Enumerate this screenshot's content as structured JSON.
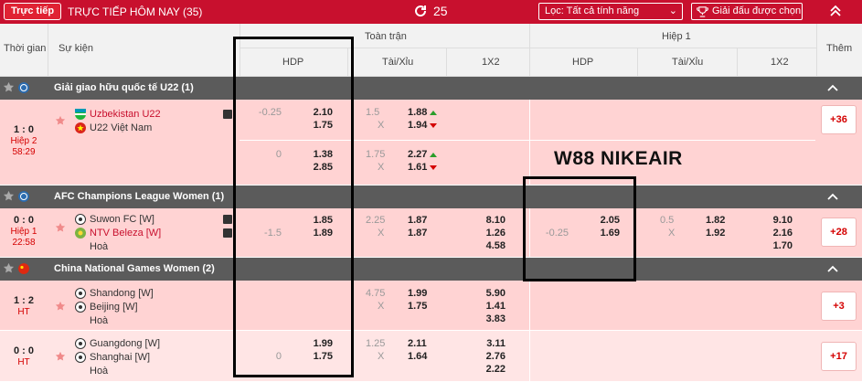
{
  "topbar": {
    "live_label": "Trực tiếp",
    "title": "TRỰC TIẾP HÔM NAY (35)",
    "refresh_count": "25",
    "filter_label": "Lọc: Tất cả tính năng",
    "league_select_label": "Giải đấu được chọn",
    "colors": {
      "bar": "#c8102e"
    }
  },
  "header": {
    "time": "Thời gian",
    "event": "Sự kiện",
    "full_match": "Toàn trận",
    "first_half": "Hiệp 1",
    "more": "Thêm",
    "hdp": "HDP",
    "ou": "Tài/Xỉu",
    "x12": "1X2",
    "hdp_h1": "HDP",
    "ou_h1": "Tài/Xỉu",
    "x12_h1": "1X2"
  },
  "leagues": [
    {
      "name": "Giải giao hữu quốc tế U22 (1)"
    },
    {
      "name": "AFC Champions League Women (1)"
    },
    {
      "name": "China National Games Women (2)"
    }
  ],
  "matches": [
    {
      "score": "1 : 0",
      "status1": "Hiệp 2",
      "status2": "58:29",
      "home": "Uzbekistan U22",
      "away": "U22 Việt Nam",
      "rows": [
        {
          "hdp_line": "-0.25",
          "hdp_home": "2.10",
          "hdp_away": "1.75",
          "ou_line": "1.5",
          "ou_x": "X",
          "ou_over": "1.88",
          "ou_under": "1.94"
        },
        {
          "hdp_line": "0",
          "hdp_home": "1.38",
          "hdp_away": "2.85",
          "ou_line": "1.75",
          "ou_x": "X",
          "ou_over": "2.27",
          "ou_under": "1.61"
        }
      ],
      "more": "+36"
    },
    {
      "score": "0 : 0",
      "status1": "Hiệp 1",
      "status2": "22:58",
      "home": "Suwon FC [W]",
      "away": "NTV Beleza [W]",
      "draw": "Hoà",
      "hdp_line": "-1.5",
      "hdp_home": "1.85",
      "hdp_away": "1.89",
      "ou_line": "2.25",
      "ou_x": "X",
      "ou_over": "1.87",
      "ou_under": "1.87",
      "x12_1": "8.10",
      "x12_2": "1.26",
      "x12_x": "4.58",
      "h1_hdp_line": "-0.25",
      "h1_hdp_home": "2.05",
      "h1_hdp_away": "1.69",
      "h1_ou_line": "0.5",
      "h1_ou_x": "X",
      "h1_ou_over": "1.82",
      "h1_ou_under": "1.92",
      "h1_x12_1": "9.10",
      "h1_x12_2": "2.16",
      "h1_x12_x": "1.70",
      "more": "+28"
    },
    {
      "score": "1 : 2",
      "status1": "HT",
      "home": "Shandong [W]",
      "away": "Beijing [W]",
      "draw": "Hoà",
      "ou_line": "4.75",
      "ou_x": "X",
      "ou_over": "1.99",
      "ou_under": "1.75",
      "x12_1": "5.90",
      "x12_2": "1.41",
      "x12_x": "3.83",
      "more": "+3"
    },
    {
      "score": "0 : 0",
      "status1": "HT",
      "home": "Guangdong [W]",
      "away": "Shanghai [W]",
      "draw": "Hoà",
      "hdp_line": "0",
      "hdp_home": "1.99",
      "hdp_away": "1.75",
      "ou_line": "1.25",
      "ou_x": "X",
      "ou_over": "2.11",
      "ou_under": "1.64",
      "x12_1": "3.11",
      "x12_2": "2.76",
      "x12_x": "2.22",
      "more": "+17"
    }
  ],
  "watermark": "W88 NIKEAIR"
}
